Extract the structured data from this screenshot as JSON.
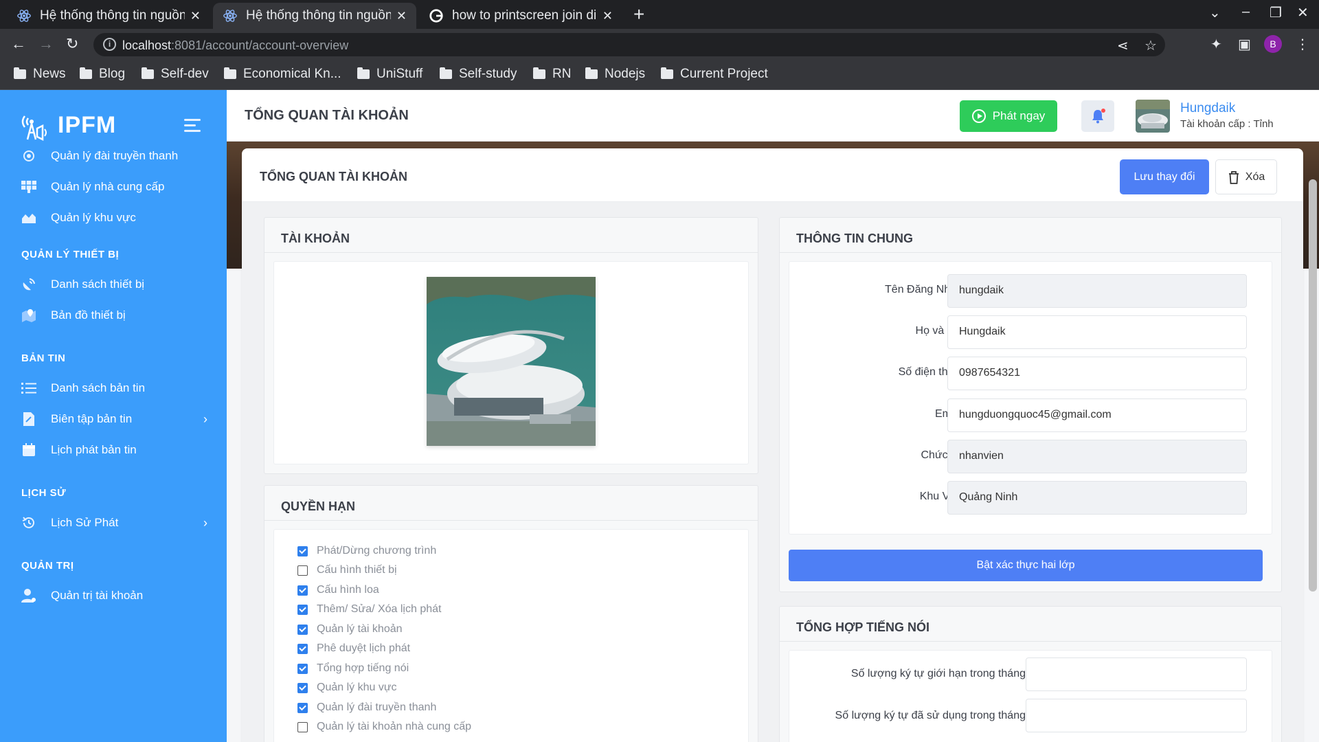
{
  "browser": {
    "tabs": [
      {
        "title": "Hệ thống thông tin nguồn"
      },
      {
        "title": "Hệ thống thông tin nguồn"
      },
      {
        "title": "how to printscreen join di"
      }
    ],
    "url_host": "localhost",
    "url_path": ":8081/account/account-overview",
    "profile_initial": "B",
    "bookmarks": [
      "News",
      "Blog",
      "Self-dev",
      "Economical Kn...",
      "UniStuff",
      "Self-study",
      "RN",
      "Nodejs",
      "Current Project"
    ]
  },
  "sidebar": {
    "brand": "IPFM",
    "items": [
      {
        "label": "Quản lý đài truyền thanh",
        "icon": "radio-tower-icon"
      },
      {
        "label": "Quản lý nhà cung cấp",
        "icon": "solar-panel-icon"
      },
      {
        "label": "Quản lý khu vực",
        "icon": "area-chart-icon"
      }
    ],
    "sections": [
      {
        "title": "QUẢN LÝ THIẾT BỊ",
        "items": [
          {
            "label": "Danh sách thiết bị",
            "icon": "satellite-dish-icon"
          },
          {
            "label": "Bản đồ thiết bị",
            "icon": "map-marker-icon"
          }
        ]
      },
      {
        "title": "BẢN TIN",
        "items": [
          {
            "label": "Danh sách bản tin",
            "icon": "list-icon"
          },
          {
            "label": "Biên tập bản tin",
            "icon": "edit-document-icon",
            "arrow": "›"
          },
          {
            "label": "Lịch phát bản tin",
            "icon": "calendar-icon"
          }
        ]
      },
      {
        "title": "LỊCH SỬ",
        "items": [
          {
            "label": "Lịch Sử Phát",
            "icon": "history-icon",
            "arrow": "›"
          }
        ]
      },
      {
        "title": "QUẢN TRỊ",
        "items": [
          {
            "label": "Quản trị tài khoản",
            "icon": "user-admin-icon"
          }
        ]
      }
    ]
  },
  "topbar": {
    "title": "TỔNG QUAN TÀI KHOẢN",
    "play_label": "Phát ngay",
    "user_name": "Hungdaik",
    "user_level": "Tài khoản cấp : Tỉnh"
  },
  "main": {
    "title": "TỔNG QUAN TÀI KHOẢN",
    "save_label": "Lưu thay đổi",
    "delete_label": "Xóa",
    "account_panel_title": "TÀI KHOẢN",
    "permissions_title": "QUYỀN HẠN",
    "permissions": [
      {
        "label": "Phát/Dừng chương trình",
        "checked": true
      },
      {
        "label": "Cấu hình thiết bị",
        "checked": false
      },
      {
        "label": "Cấu hình loa",
        "checked": true
      },
      {
        "label": "Thêm/ Sửa/ Xóa lịch phát",
        "checked": true
      },
      {
        "label": "Quản lý tài khoản",
        "checked": true
      },
      {
        "label": "Phê duyệt lịch phát",
        "checked": true
      },
      {
        "label": "Tổng hợp tiếng nói",
        "checked": true
      },
      {
        "label": "Quản lý khu vực",
        "checked": true
      },
      {
        "label": "Quản lý đài truyền thanh",
        "checked": true
      },
      {
        "label": "Quản lý tài khoản nhà cung cấp",
        "checked": false
      }
    ],
    "general_info_title": "THÔNG TIN CHUNG",
    "fields": [
      {
        "label": "Tên Đăng Nhập",
        "value": "hungdaik",
        "editable": false
      },
      {
        "label": "Họ và tên",
        "value": "Hungdaik",
        "editable": true
      },
      {
        "label": "Số điện thoại",
        "value": "0987654321",
        "editable": true
      },
      {
        "label": "Email",
        "value": "hungduongquoc45@gmail.com",
        "editable": true
      },
      {
        "label": "Chức vụ",
        "value": "nhanvien",
        "editable": false
      },
      {
        "label": "Khu Vực",
        "value": "Quảng Ninh",
        "editable": false
      }
    ],
    "two_factor_label": "Bật xác thực hai lớp",
    "speech_title": "TỔNG HỢP TIẾNG NÓI",
    "speech_fields": [
      {
        "label": "Số lượng ký tự giới hạn trong tháng",
        "value": ""
      },
      {
        "label": "Số lượng ký tự đã sử dụng trong tháng",
        "value": ""
      }
    ]
  },
  "colors": {
    "sidebar": "#3b9dfb",
    "primary_button": "#4e7ff5",
    "play_button": "#2ecc5a",
    "checkbox": "#2f80ed"
  }
}
